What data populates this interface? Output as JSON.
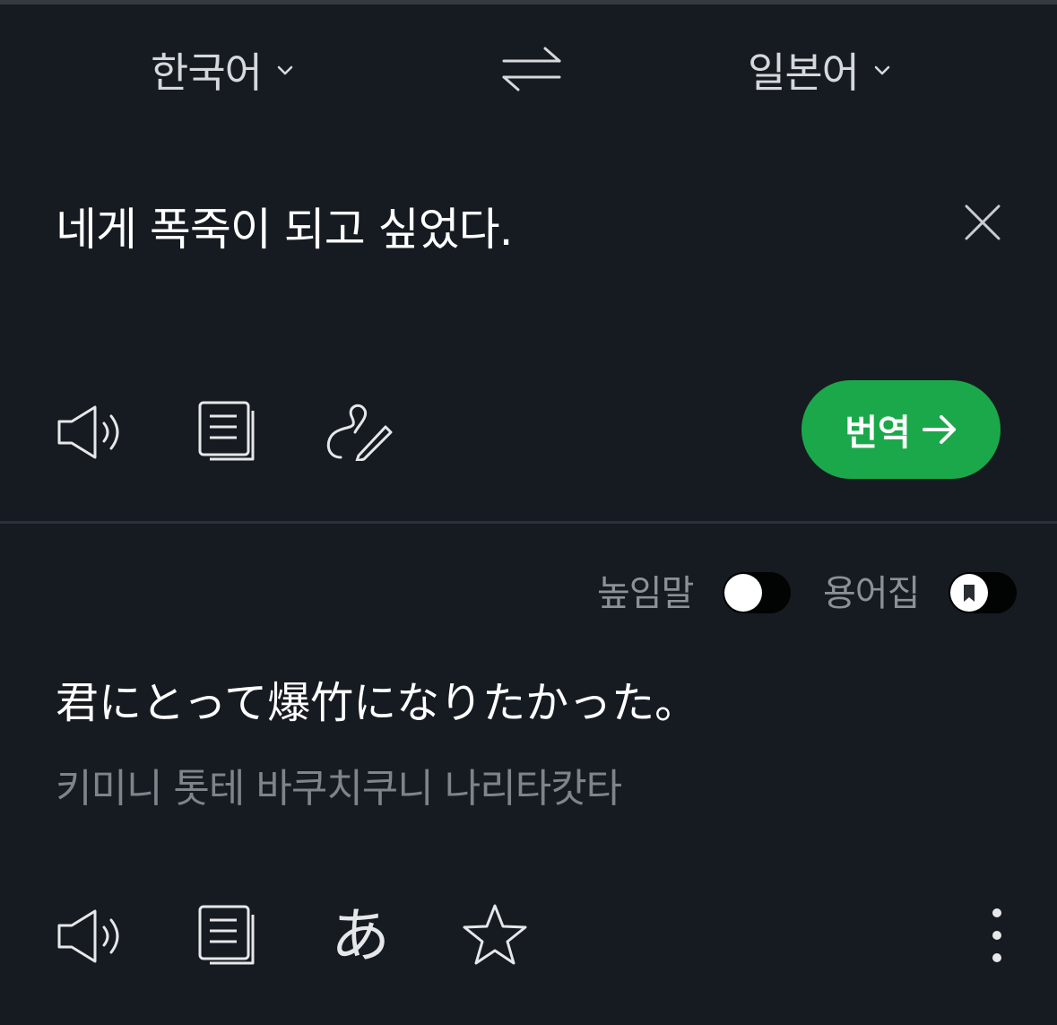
{
  "languages": {
    "source": "한국어",
    "target": "일본어"
  },
  "source_text": "네게 폭죽이 되고 싶었다.",
  "translate_button": {
    "label": "번역",
    "color": "#1ba84a"
  },
  "toggles": {
    "honorific_label": "높임말",
    "glossary_label": "용어집"
  },
  "result": {
    "text": "君にとって爆竹になりたかった。",
    "pronunciation": "키미니 톳테 바쿠치쿠니 나리타캇타",
    "hiragana_label": "あ"
  },
  "icons": {
    "source_actions": [
      "speaker-icon",
      "copy-icon",
      "handwriting-icon"
    ],
    "result_actions": [
      "speaker-icon",
      "copy-icon",
      "hiragana-icon",
      "star-icon",
      "more-icon"
    ]
  }
}
